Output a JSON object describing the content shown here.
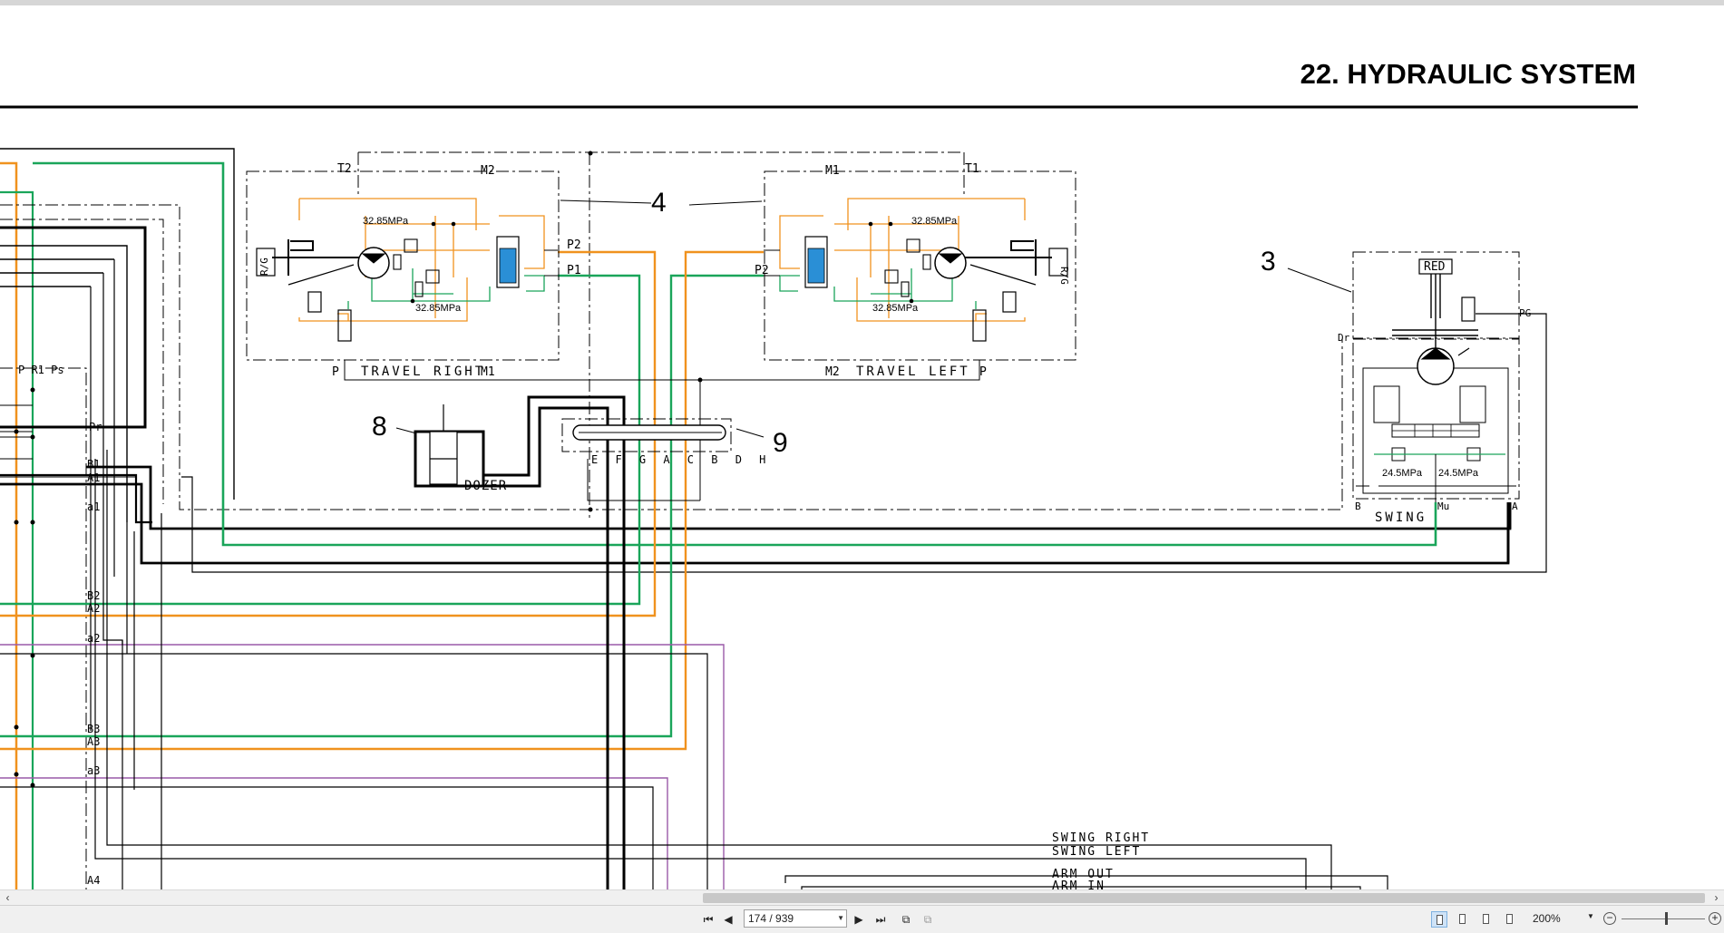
{
  "document": {
    "section_title": "22.  HYDRAULIC SYSTEM",
    "callouts": {
      "c3": "3",
      "c4": "4",
      "c8": "8",
      "c9": "9"
    },
    "labels": {
      "travel_right": "TRAVEL RIGHT",
      "travel_left": "TRAVEL LEFT",
      "swing": "SWING",
      "dozer": "DOZER",
      "red": "RED",
      "p_32_85": "32.85MPa",
      "p_24_5": "24.5MPa",
      "t1": "T1",
      "t2": "T2",
      "m1": "M1",
      "m2": "M2",
      "p": "P",
      "p1": "P1",
      "p2": "P2",
      "pg": "PG",
      "dr": "Dr",
      "mu": "Mu",
      "a": "A",
      "b": "B",
      "rg": "R/G",
      "valve_ports": "E F G A C B D H",
      "p_r1_ps": "P  R1   Ps",
      "pr": "Pr",
      "b1": "B1",
      "a1": "A1",
      "a1_small": "a1",
      "b2": "B2",
      "a2": "A2",
      "a2_small": "a2",
      "b3": "B3",
      "a3": "A3",
      "a3_small": "a3",
      "a4": "A4",
      "swing_right": "SWING RIGHT",
      "swing_left": "SWING LEFT",
      "arm_out": "ARM OUT",
      "arm_in": "ARM IN"
    }
  },
  "statusbar": {
    "page_field": "174 / 939",
    "zoom": "200%"
  },
  "colors": {
    "orange": "#f0921e",
    "green": "#1aa55a",
    "purple": "#9a5aa8",
    "black": "#000000",
    "blue": "#2a8fd6"
  }
}
